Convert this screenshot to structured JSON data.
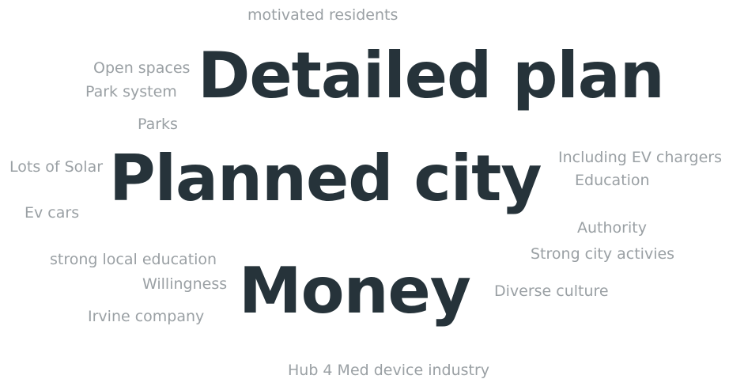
{
  "word_cloud": {
    "colors": {
      "primary_word": "#26333a",
      "secondary_word": "#9aa0a4",
      "background": "#ffffff"
    },
    "primary_words": [
      "Detailed plan",
      "Planned city",
      "Money"
    ],
    "secondary_words": [
      "motivated residents",
      "Open spaces",
      "Park system",
      "Parks",
      "Lots of Solar",
      "Ev cars",
      "strong local education",
      "Willingness",
      "Irvine company",
      "Including EV chargers",
      "Education",
      "Authority",
      "Strong city activies",
      "Diverse culture",
      "Hub 4 Med device industry"
    ]
  }
}
